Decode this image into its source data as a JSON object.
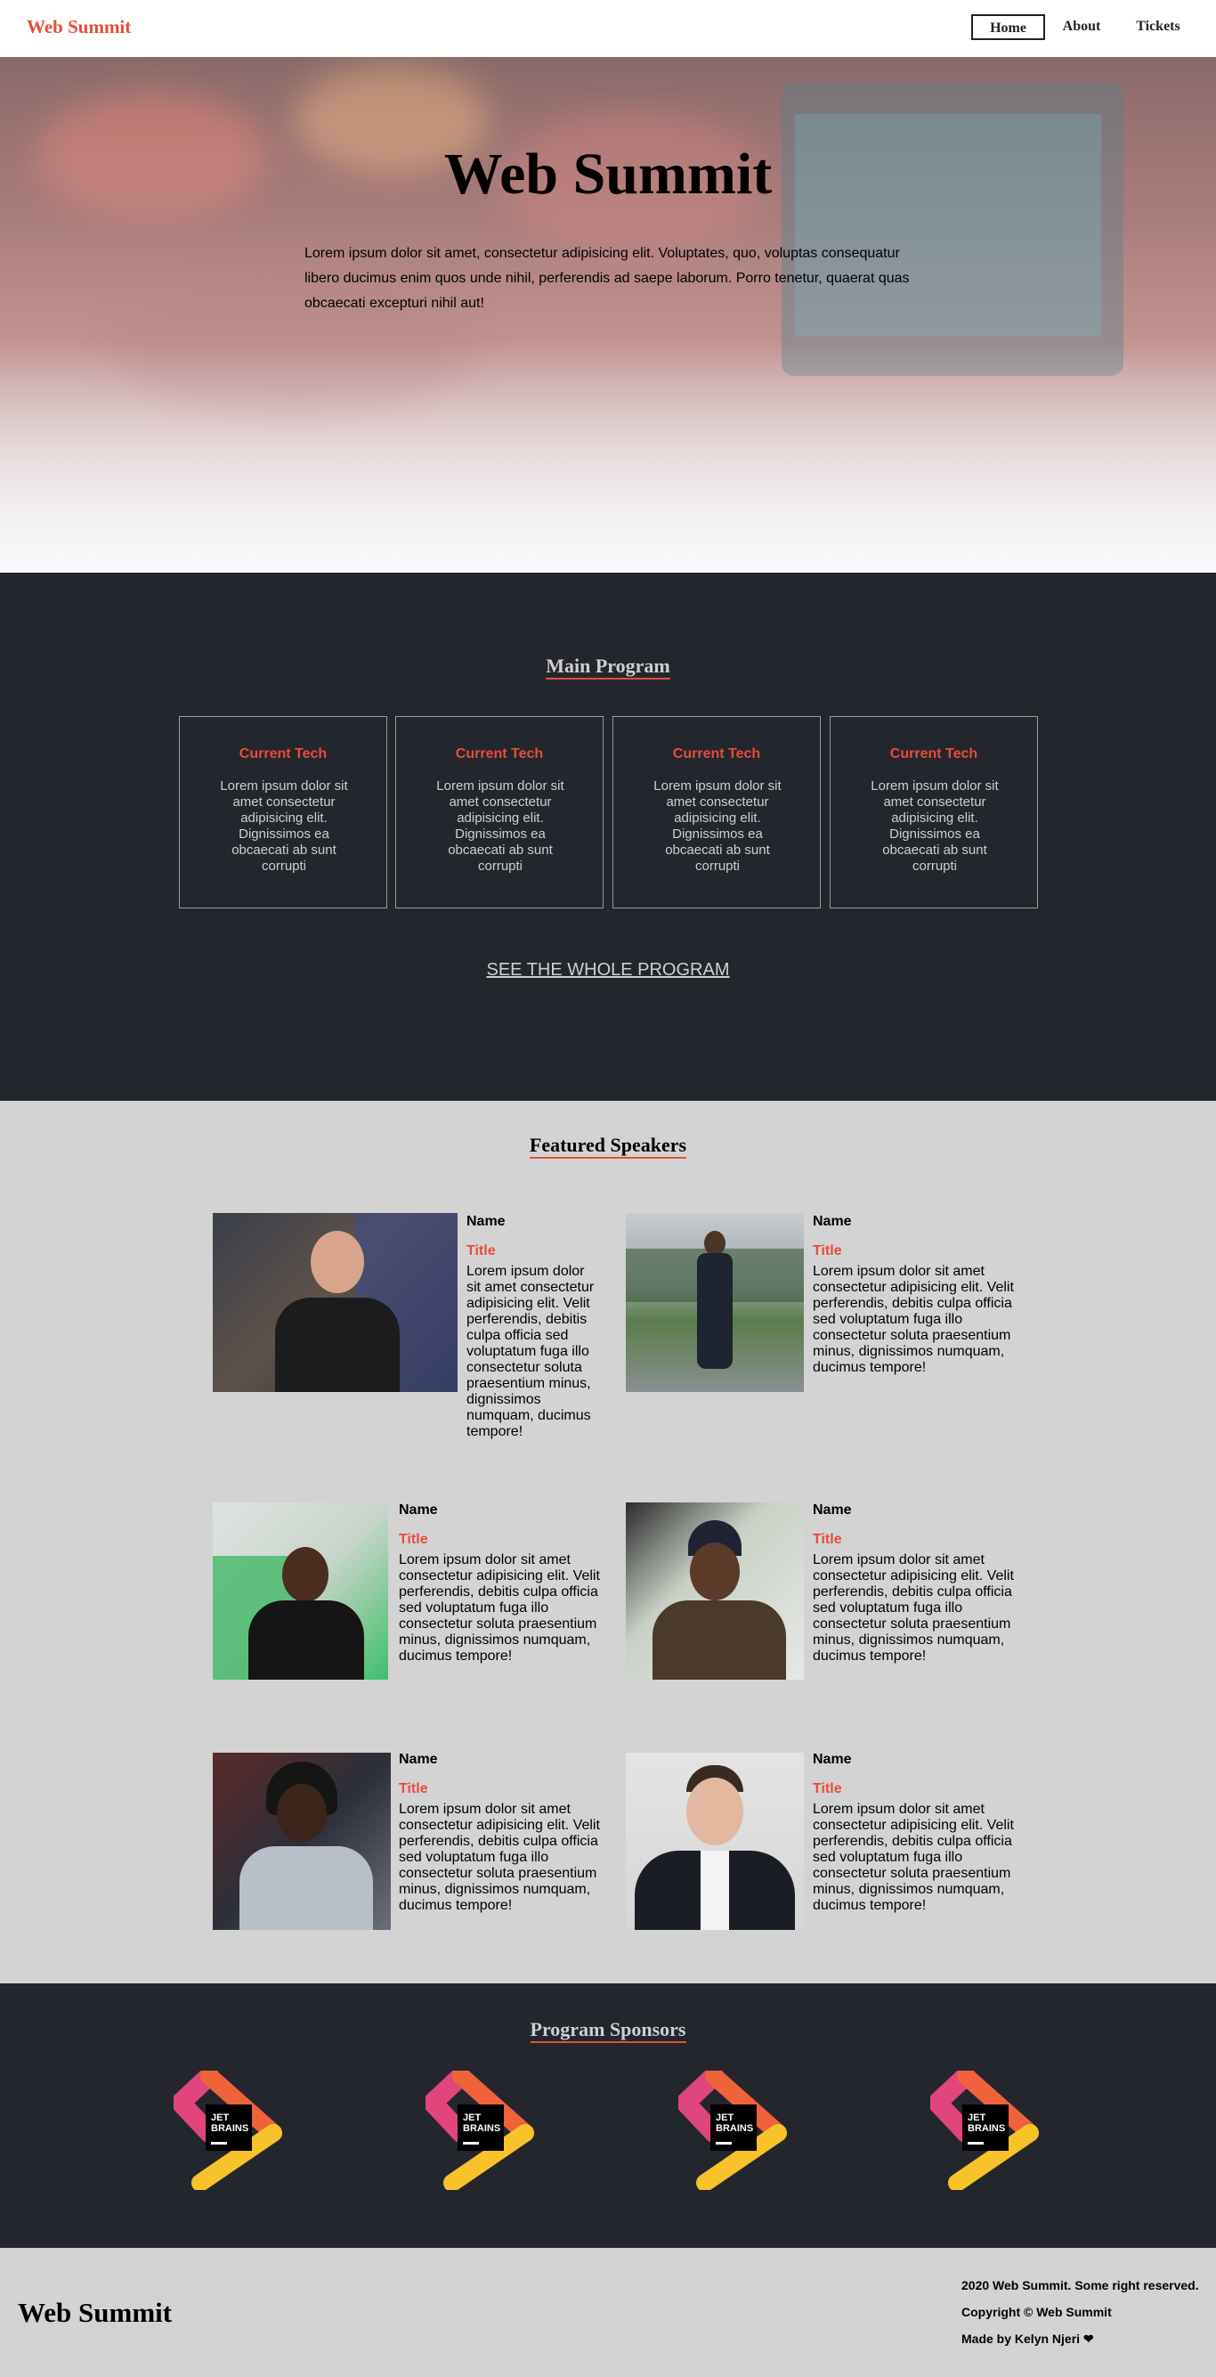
{
  "nav": {
    "logo": "Web Summit",
    "links": [
      {
        "label": "Home"
      },
      {
        "label": "About"
      },
      {
        "label": "Tickets"
      }
    ]
  },
  "hero": {
    "title": "Web Summit",
    "text": "Lorem ipsum dolor sit amet, consectetur adipisicing elit. Voluptates, quo, voluptas consequatur libero ducimus enim quos unde nihil, perferendis ad saepe laborum. Porro tenetur, quaerat quas obcaecati excepturi nihil aut!"
  },
  "program": {
    "title": "Main Program",
    "cards": [
      {
        "title": "Current Tech",
        "text": "Lorem ipsum dolor sit amet consectetur adipisicing elit. Dignissimos ea obcaecati ab sunt corrupti"
      },
      {
        "title": "Current Tech",
        "text": "Lorem ipsum dolor sit amet consectetur adipisicing elit. Dignissimos ea obcaecati ab sunt corrupti"
      },
      {
        "title": "Current Tech",
        "text": "Lorem ipsum dolor sit amet consectetur adipisicing elit. Dignissimos ea obcaecati ab sunt corrupti"
      },
      {
        "title": "Current Tech",
        "text": "Lorem ipsum dolor sit amet consectetur adipisicing elit. Dignissimos ea obcaecati ab sunt corrupti"
      }
    ],
    "see_all": "SEE THE WHOLE PROGRAM"
  },
  "speakers": {
    "title": "Featured Speakers",
    "items": [
      {
        "name": "Name",
        "title": "Title",
        "bio": "Lorem ipsum dolor sit amet consectetur adipisicing elit. Velit perferendis, debitis culpa officia sed voluptatum fuga illo consectetur soluta praesentium minus, dignissimos numquam, ducimus tempore!"
      },
      {
        "name": "Name",
        "title": "Title",
        "bio": "Lorem ipsum dolor sit amet consectetur adipisicing elit. Velit perferendis, debitis culpa officia sed voluptatum fuga illo consectetur soluta praesentium minus, dignissimos numquam, ducimus tempore!"
      },
      {
        "name": "Name",
        "title": "Title",
        "bio": "Lorem ipsum dolor sit amet consectetur adipisicing elit. Velit perferendis, debitis culpa officia sed voluptatum fuga illo consectetur soluta praesentium minus, dignissimos numquam, ducimus tempore!"
      },
      {
        "name": "Name",
        "title": "Title",
        "bio": "Lorem ipsum dolor sit amet consectetur adipisicing elit. Velit perferendis, debitis culpa officia sed voluptatum fuga illo consectetur soluta praesentium minus, dignissimos numquam, ducimus tempore!"
      },
      {
        "name": "Name",
        "title": "Title",
        "bio": "Lorem ipsum dolor sit amet consectetur adipisicing elit. Velit perferendis, debitis culpa officia sed voluptatum fuga illo consectetur soluta praesentium minus, dignissimos numquam, ducimus tempore!"
      },
      {
        "name": "Name",
        "title": "Title",
        "bio": "Lorem ipsum dolor sit amet consectetur adipisicing elit. Velit perferendis, debitis culpa officia sed voluptatum fuga illo consectetur soluta praesentium minus, dignissimos numquam, ducimus tempore!"
      }
    ]
  },
  "sponsors": {
    "title": "Program Sponsors",
    "logo_text_1": "JET",
    "logo_text_2": "BRAINS"
  },
  "footer": {
    "logo": "Web Summit",
    "line1": "2020 Web Summit. Some right reserved.",
    "line2": "Copyright © Web Summit",
    "line3": "Made by Kelyn Njeri ❤"
  },
  "colors": {
    "accent": "#e74c3c",
    "dark": "#24262e",
    "light": "#d3d3d3"
  }
}
